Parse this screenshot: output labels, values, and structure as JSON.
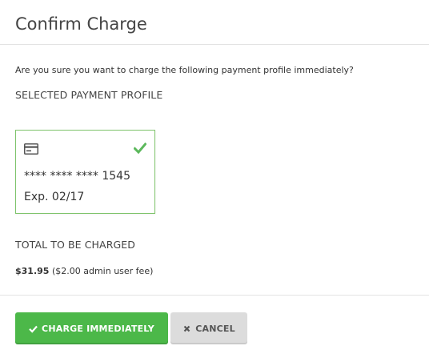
{
  "modal": {
    "title": "Confirm Charge",
    "question": "Are you sure you want to charge the following payment profile immediately?"
  },
  "selected_profile": {
    "section_label": "SELECTED PAYMENT PROFILE",
    "card_icon": "credit-card-icon",
    "selected_icon": "checkmark-icon",
    "masked_number": "**** **** **** 1545",
    "expiration": "Exp. 02/17",
    "border_color": "#7ec46b",
    "check_color": "#5cb85c"
  },
  "total": {
    "section_label": "TOTAL TO BE CHARGED",
    "amount": "$31.95",
    "fee_note": "($2.00 admin user fee)"
  },
  "footer": {
    "charge_label": "CHARGE IMMEDIATELY",
    "charge_icon": "checkmark-icon",
    "charge_color": "#4cb849",
    "cancel_label": "CANCEL",
    "cancel_icon": "close-x-icon",
    "cancel_color": "#dcdcdc"
  }
}
